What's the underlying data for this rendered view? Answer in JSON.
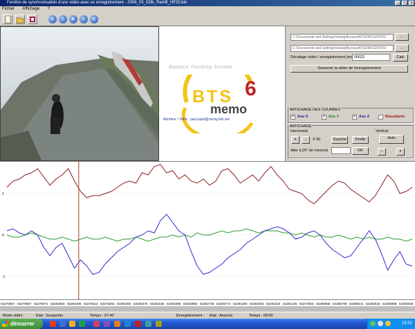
{
  "window": {
    "title": "Fenêtre de synchronisation d'une vidéo avec un enregistrement - 2008_03_02tb_RamB_HF20.bin"
  },
  "menu": [
    "Fichier",
    "Affichage",
    "?"
  ],
  "toolbar": {
    "icons": [
      "new-file-icon",
      "open-folder-icon",
      "video-icon",
      "first-icon",
      "rewind-icon",
      "play-icon",
      "forward-icon",
      "last-icon"
    ]
  },
  "logo": {
    "header": "Balance Tracking System",
    "bts": "BTS",
    "six": "6",
    "memo": "memo",
    "footer": "Bonheur ! Votre : paul.pujol@racing-bts.net"
  },
  "panel": {
    "path1": "C:\\Documents and Settings\\Varlag\\Bureau\\ATGRM\\CENTRO",
    "path2": "C:\\Documents and Settings\\Varlag\\Bureau\\ATGRM\\CENTRO",
    "browse": "...",
    "offset_label": "Décalage vidéo / enregistrement (ms)",
    "offset_value": "00022",
    "calc": "Calc",
    "dissociate": "Dissocier la vidéo de l'enregistrement",
    "curves_title": "AFFICHAGE DES COURBES",
    "axe_x": "Axe X",
    "axe_y": "Axe Y",
    "axe_z": "Axe Z",
    "resultante": "Résultante",
    "display_title": "AFFICHAGE",
    "horizontal": "Horizontal",
    "vertical": "Vertical",
    "plus": "+",
    "minus": "-",
    "zoom": "X 50",
    "gauche": "Gauche",
    "droite": "Droite",
    "auto": "Auto",
    "goto_label": "Aller à (N° de mesure)",
    "ok": "OK"
  },
  "chart_data": {
    "type": "line",
    "x": [
      53276907,
      53279897,
      53279072,
      53282683,
      53284408,
      53278313,
      53278263,
      53280363,
      53280279,
      53281635,
      53284088,
      53283963,
      53282738,
      53284774,
      53281359,
      53283363,
      53284234,
      53284125,
      53273003,
      53286868,
      53285799,
      53286541,
      53284518,
      53280868,
      53280028
    ],
    "yticks": [
      "1",
      "0",
      "-1"
    ],
    "ylim": [
      -1.5,
      1.7
    ],
    "cursor_index": 3,
    "colors": {
      "x": "#8b1a1a",
      "y": "#2e9a2e",
      "z": "#2a2ad0",
      "cursor": "#b04020"
    },
    "series": [
      {
        "key": "x",
        "values": [
          1.15,
          1.3,
          1.35,
          1.45,
          1.5,
          1.6,
          1.4,
          1.2,
          1.35,
          1.45,
          1.6,
          1.3,
          1.05,
          0.9,
          0.95,
          0.95,
          1.0,
          1.05,
          1.15,
          1.25,
          1.3,
          1.25,
          1.5,
          1.45,
          1.65,
          1.7,
          1.5,
          1.55,
          1.35,
          1.45,
          1.3,
          1.25,
          1.35,
          1.2,
          1.3,
          1.55,
          1.6,
          1.45,
          1.25,
          1.35,
          1.45,
          1.3,
          1.5,
          1.65,
          1.45,
          1.3,
          1.1,
          1.05,
          1.0,
          0.85,
          0.75,
          0.9,
          1.05,
          1.2,
          1.3,
          1.25,
          1.1,
          1.0,
          0.9,
          0.8,
          0.95,
          1.2,
          1.45,
          1.3,
          1.0,
          1.05,
          1.15
        ]
      },
      {
        "key": "y",
        "values": [
          0.0,
          -0.05,
          -0.05,
          0.0,
          0.05,
          0.0,
          -0.05,
          -0.1,
          -0.1,
          -0.05,
          -0.1,
          -0.15,
          -0.1,
          -0.05,
          -0.1,
          -0.1,
          -0.05,
          -0.1,
          -0.15,
          -0.1,
          -0.1,
          -0.05,
          -0.1,
          -0.15,
          -0.1,
          -0.05,
          -0.05,
          0.0,
          -0.05,
          0.0,
          -0.05,
          0.05,
          0.0,
          0.0,
          0.05,
          0.1,
          0.05,
          0.1,
          0.1,
          0.15,
          0.1,
          0.05,
          0.1,
          0.1,
          0.1,
          0.05,
          0.05,
          0.0,
          0.05,
          0.0,
          -0.05,
          0.0,
          -0.05,
          -0.05,
          0.0,
          -0.05,
          -0.1,
          -0.05,
          -0.1,
          -0.05,
          -0.1,
          -0.1,
          -0.05,
          -0.1,
          -0.1,
          -0.15,
          -0.1
        ]
      },
      {
        "key": "z",
        "values": [
          0.1,
          0.15,
          0.05,
          0.0,
          0.1,
          0.0,
          -0.3,
          -0.5,
          -0.3,
          -0.2,
          -0.5,
          -0.8,
          -0.6,
          -0.75,
          -0.95,
          -0.9,
          -0.7,
          -0.55,
          -0.4,
          -0.3,
          -0.2,
          -0.05,
          0.0,
          0.1,
          0.05,
          0.35,
          0.5,
          0.3,
          0.1,
          0.0,
          -0.4,
          -0.75,
          -0.95,
          -0.9,
          -0.8,
          -0.7,
          -0.55,
          -0.45,
          -0.35,
          -0.2,
          -0.1,
          0.0,
          0.1,
          0.15,
          0.2,
          0.15,
          0.05,
          -0.1,
          -0.05,
          0.05,
          0.1,
          0.0,
          -0.2,
          -0.35,
          -0.45,
          -0.55,
          -0.5,
          -0.3,
          -0.1,
          0.1,
          -0.1,
          -0.45,
          -0.85,
          -0.6,
          -0.4,
          -0.7,
          -0.75
        ]
      }
    ]
  },
  "status": {
    "mode": "Mode vidéo :",
    "etat_video": "Etat : Suspendu",
    "temps_video": "Temps : 07:40",
    "enreg": "Enregistrement :",
    "etat_enreg": "Etat : Associé",
    "temps_enreg": "Temps : 09:00"
  },
  "taskbar": {
    "start": "démarrer",
    "clock": "15:52"
  }
}
